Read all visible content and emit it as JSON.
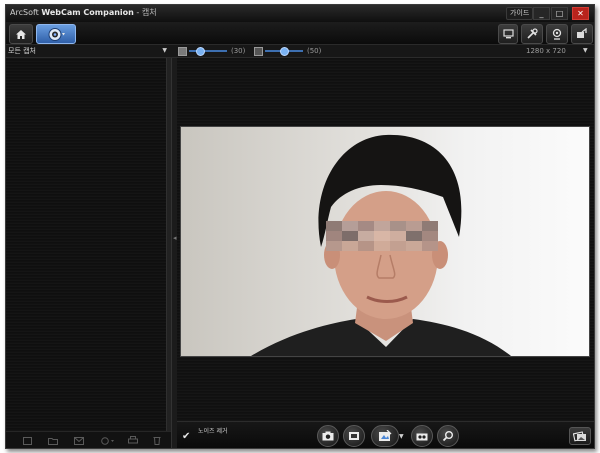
{
  "window": {
    "app_name_prefix": "ArcSoft",
    "app_name_bold": "WebCam Companion",
    "separator": "-",
    "page_name": "캡처",
    "help_label": "가이드",
    "min_label": "_",
    "max_label": "□",
    "close_label": "✕"
  },
  "toolbar": {
    "home_icon": "home-icon",
    "capture_tab_icon": "webcam-icon",
    "right_icons": [
      "display-settings-icon",
      "tools-icon",
      "webcam-settings-icon",
      "share-icon"
    ]
  },
  "options": {
    "folder_label": "모든 캡처",
    "brightness_value": "(30)",
    "contrast_value": "(50)",
    "brightness_level": 0.3,
    "contrast_level": 0.5,
    "resolution": "1280 x 720"
  },
  "bottom": {
    "remove_noise_label": "노이즈 제거",
    "checkbox_mark": "✔",
    "buttons": [
      "camera-snapshot-icon",
      "video-record-icon",
      "effects-icon",
      "burst-capture-icon",
      "zoom-icon",
      "gallery-icon"
    ]
  },
  "left_bottom_icons": [
    "upload-icon",
    "folder-icon",
    "email-icon",
    "share-icon",
    "print-icon",
    "delete-icon"
  ],
  "colors": {
    "accent": "#4a86d6",
    "close": "#b9231c",
    "background": "#101010"
  }
}
